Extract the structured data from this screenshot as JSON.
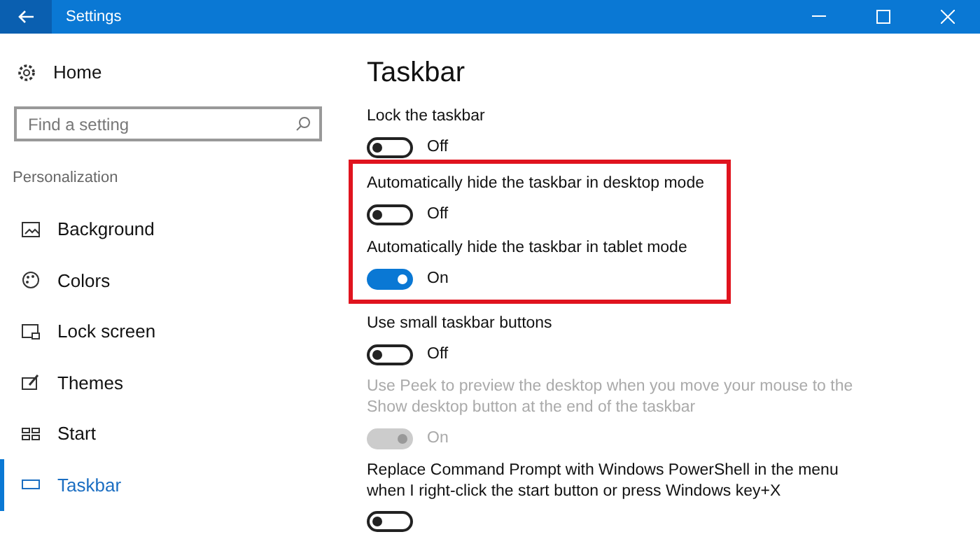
{
  "window": {
    "title": "Settings"
  },
  "sidebar": {
    "home": "Home",
    "search": {
      "placeholder": "Find a setting"
    },
    "section": "Personalization",
    "items": [
      {
        "label": "Background",
        "kind": "picture",
        "selected": false
      },
      {
        "label": "Colors",
        "kind": "palette",
        "selected": false
      },
      {
        "label": "Lock screen",
        "kind": "lock",
        "selected": false
      },
      {
        "label": "Themes",
        "kind": "themes",
        "selected": false
      },
      {
        "label": "Start",
        "kind": "start",
        "selected": false
      },
      {
        "label": "Taskbar",
        "kind": "taskbar",
        "selected": true
      }
    ]
  },
  "page": {
    "title": "Taskbar",
    "settings": [
      {
        "label": "Lock the taskbar",
        "on": false,
        "state": "Off",
        "disabled": false,
        "highlighted": false
      },
      {
        "label": "Automatically hide the taskbar in desktop mode",
        "on": false,
        "state": "Off",
        "disabled": false,
        "highlighted": true
      },
      {
        "label": "Automatically hide the taskbar in tablet mode",
        "on": true,
        "state": "On",
        "disabled": false,
        "highlighted": true
      },
      {
        "label": "Use small taskbar buttons",
        "on": false,
        "state": "Off",
        "disabled": false,
        "highlighted": false
      },
      {
        "label": "Use Peek to preview the desktop when you move your mouse to the Show desktop button at the end of the taskbar",
        "on": true,
        "state": "On",
        "disabled": true,
        "highlighted": false
      },
      {
        "label": "Replace Command Prompt with Windows PowerShell in the menu when I right-click the start button or press Windows key+X",
        "on": false,
        "disabled": false,
        "highlighted": false
      }
    ]
  }
}
